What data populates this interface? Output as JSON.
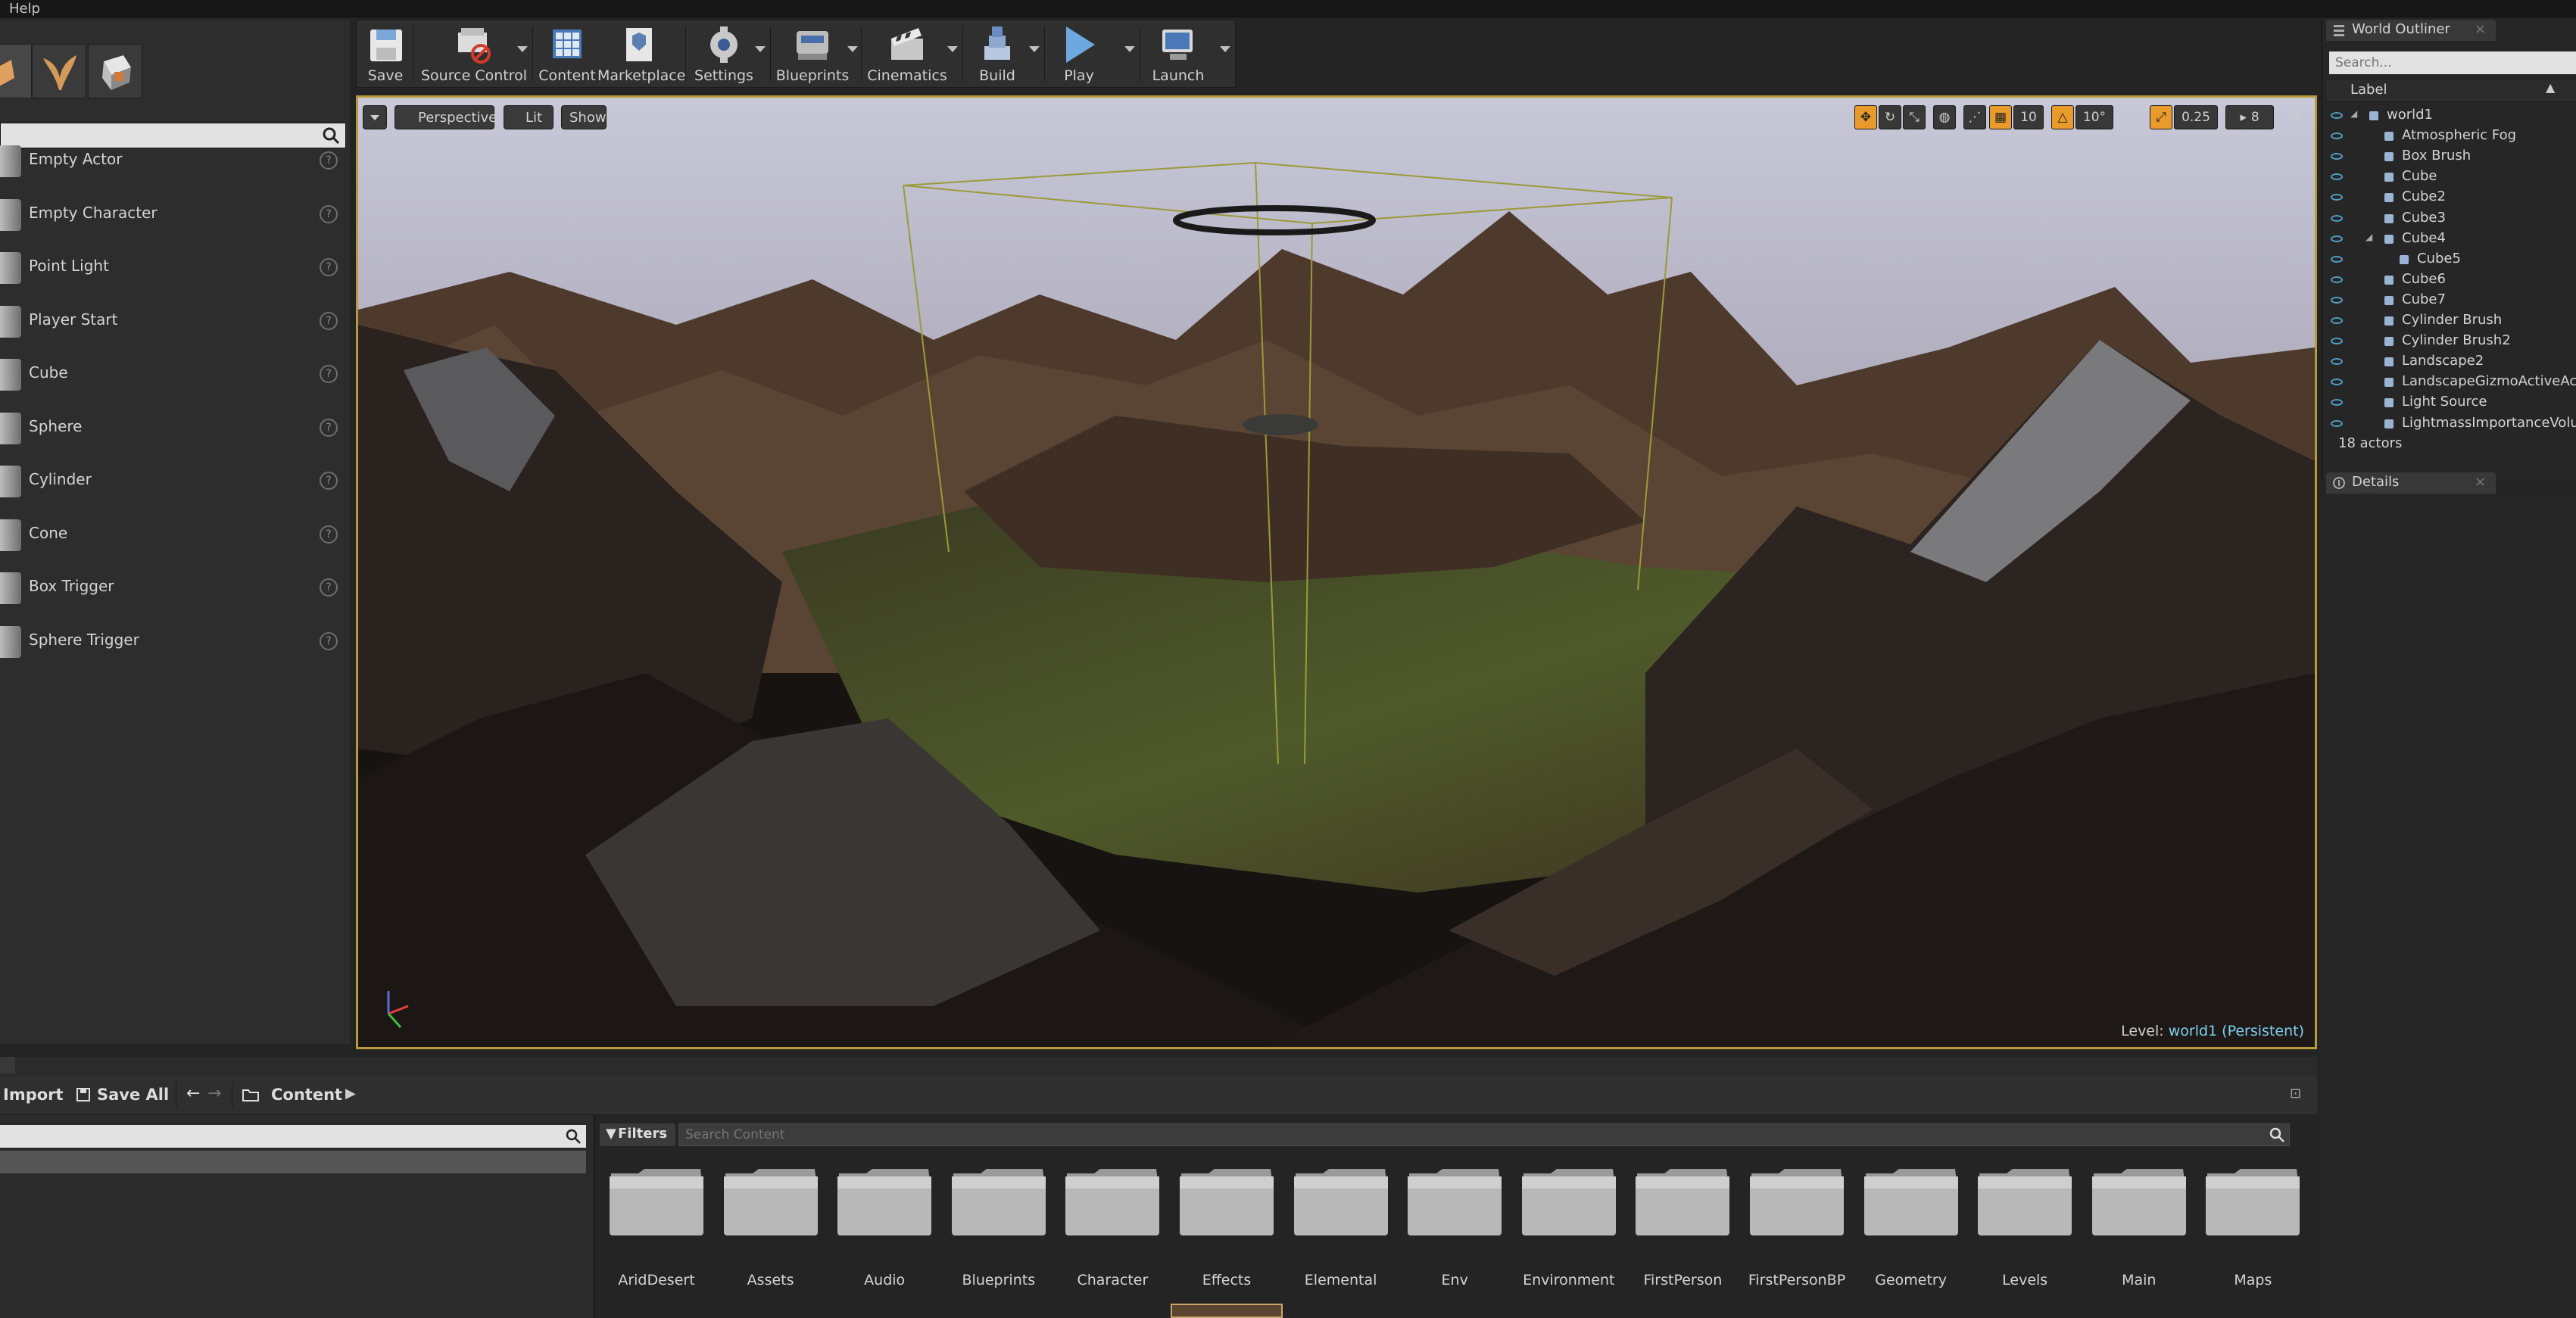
{
  "menu": {
    "help": "Help"
  },
  "modes": {
    "tabs": [
      "place-mode-icon",
      "foliage-mode-icon",
      "geometry-mode-icon"
    ],
    "items": [
      {
        "label": "Empty Actor",
        "icon": "sphere-thumb"
      },
      {
        "label": "Empty Character",
        "icon": "character-thumb"
      },
      {
        "label": "Point Light",
        "icon": "light-thumb"
      },
      {
        "label": "Player Start",
        "icon": "player-thumb"
      },
      {
        "label": "Cube",
        "icon": "cube-thumb"
      },
      {
        "label": "Sphere",
        "icon": "sphere-thumb"
      },
      {
        "label": "Cylinder",
        "icon": "cylinder-thumb"
      },
      {
        "label": "Cone",
        "icon": "cone-thumb"
      },
      {
        "label": "Box Trigger",
        "icon": "box-thumb"
      },
      {
        "label": "Sphere Trigger",
        "icon": "sphere-thumb"
      }
    ]
  },
  "toolbar": {
    "save": "Save",
    "source_control": "Source Control",
    "content": "Content",
    "marketplace": "Marketplace",
    "settings": "Settings",
    "blueprints": "Blueprints",
    "cinematics": "Cinematics",
    "build": "Build",
    "play": "Play",
    "launch": "Launch"
  },
  "viewport": {
    "perspective": "Perspective",
    "lit": "Lit",
    "show": "Show",
    "grid_snap": "10",
    "rotation_snap": "10°",
    "scale_snap": "0.25",
    "camera_speed": "8",
    "level_label": "Level:",
    "level_name": "world1 (Persistent)"
  },
  "outliner": {
    "tab": "World Outliner",
    "search_placeholder": "Search...",
    "column_label": "Label",
    "rows": [
      {
        "label": "world1",
        "icon": "world-icon"
      },
      {
        "label": "Atmospheric Fog",
        "icon": "fog-icon"
      },
      {
        "label": "Box Brush",
        "icon": "brush-icon"
      },
      {
        "label": "Cube",
        "icon": "actor-icon"
      },
      {
        "label": "Cube2",
        "icon": "actor-icon"
      },
      {
        "label": "Cube3",
        "icon": "actor-icon"
      },
      {
        "label": "Cube4",
        "icon": "actor-icon"
      },
      {
        "label": "Cube5",
        "icon": "actor-icon"
      },
      {
        "label": "Cube6",
        "icon": "actor-icon"
      },
      {
        "label": "Cube7",
        "icon": "actor-icon"
      },
      {
        "label": "Cylinder Brush",
        "icon": "brush-icon"
      },
      {
        "label": "Cylinder Brush2",
        "icon": "brush-icon"
      },
      {
        "label": "Landscape2",
        "icon": "landscape-icon"
      },
      {
        "label": "LandscapeGizmoActiveActor",
        "icon": "gizmo-icon"
      },
      {
        "label": "Light Source",
        "icon": "light-icon"
      },
      {
        "label": "LightmassImportanceVolume",
        "icon": "volume-icon"
      }
    ],
    "actor_count": "18 actors"
  },
  "details": {
    "tab": "Details"
  },
  "content_browser": {
    "import": "Import",
    "save_all": "Save All",
    "path": "Content",
    "filters": "Filters",
    "search_placeholder": "Search Content",
    "folders": [
      "AridDesert",
      "Assets",
      "Audio",
      "Blueprints",
      "Character",
      "Effects",
      "Elemental",
      "Env",
      "Environment",
      "FirstPerson",
      "FirstPersonBP",
      "Geometry",
      "Levels",
      "Main",
      "Maps"
    ]
  },
  "colors": {
    "selection_border": "#b89a3a",
    "accent_blue": "#4fa0c8",
    "level_text": "#7ed0f0"
  }
}
